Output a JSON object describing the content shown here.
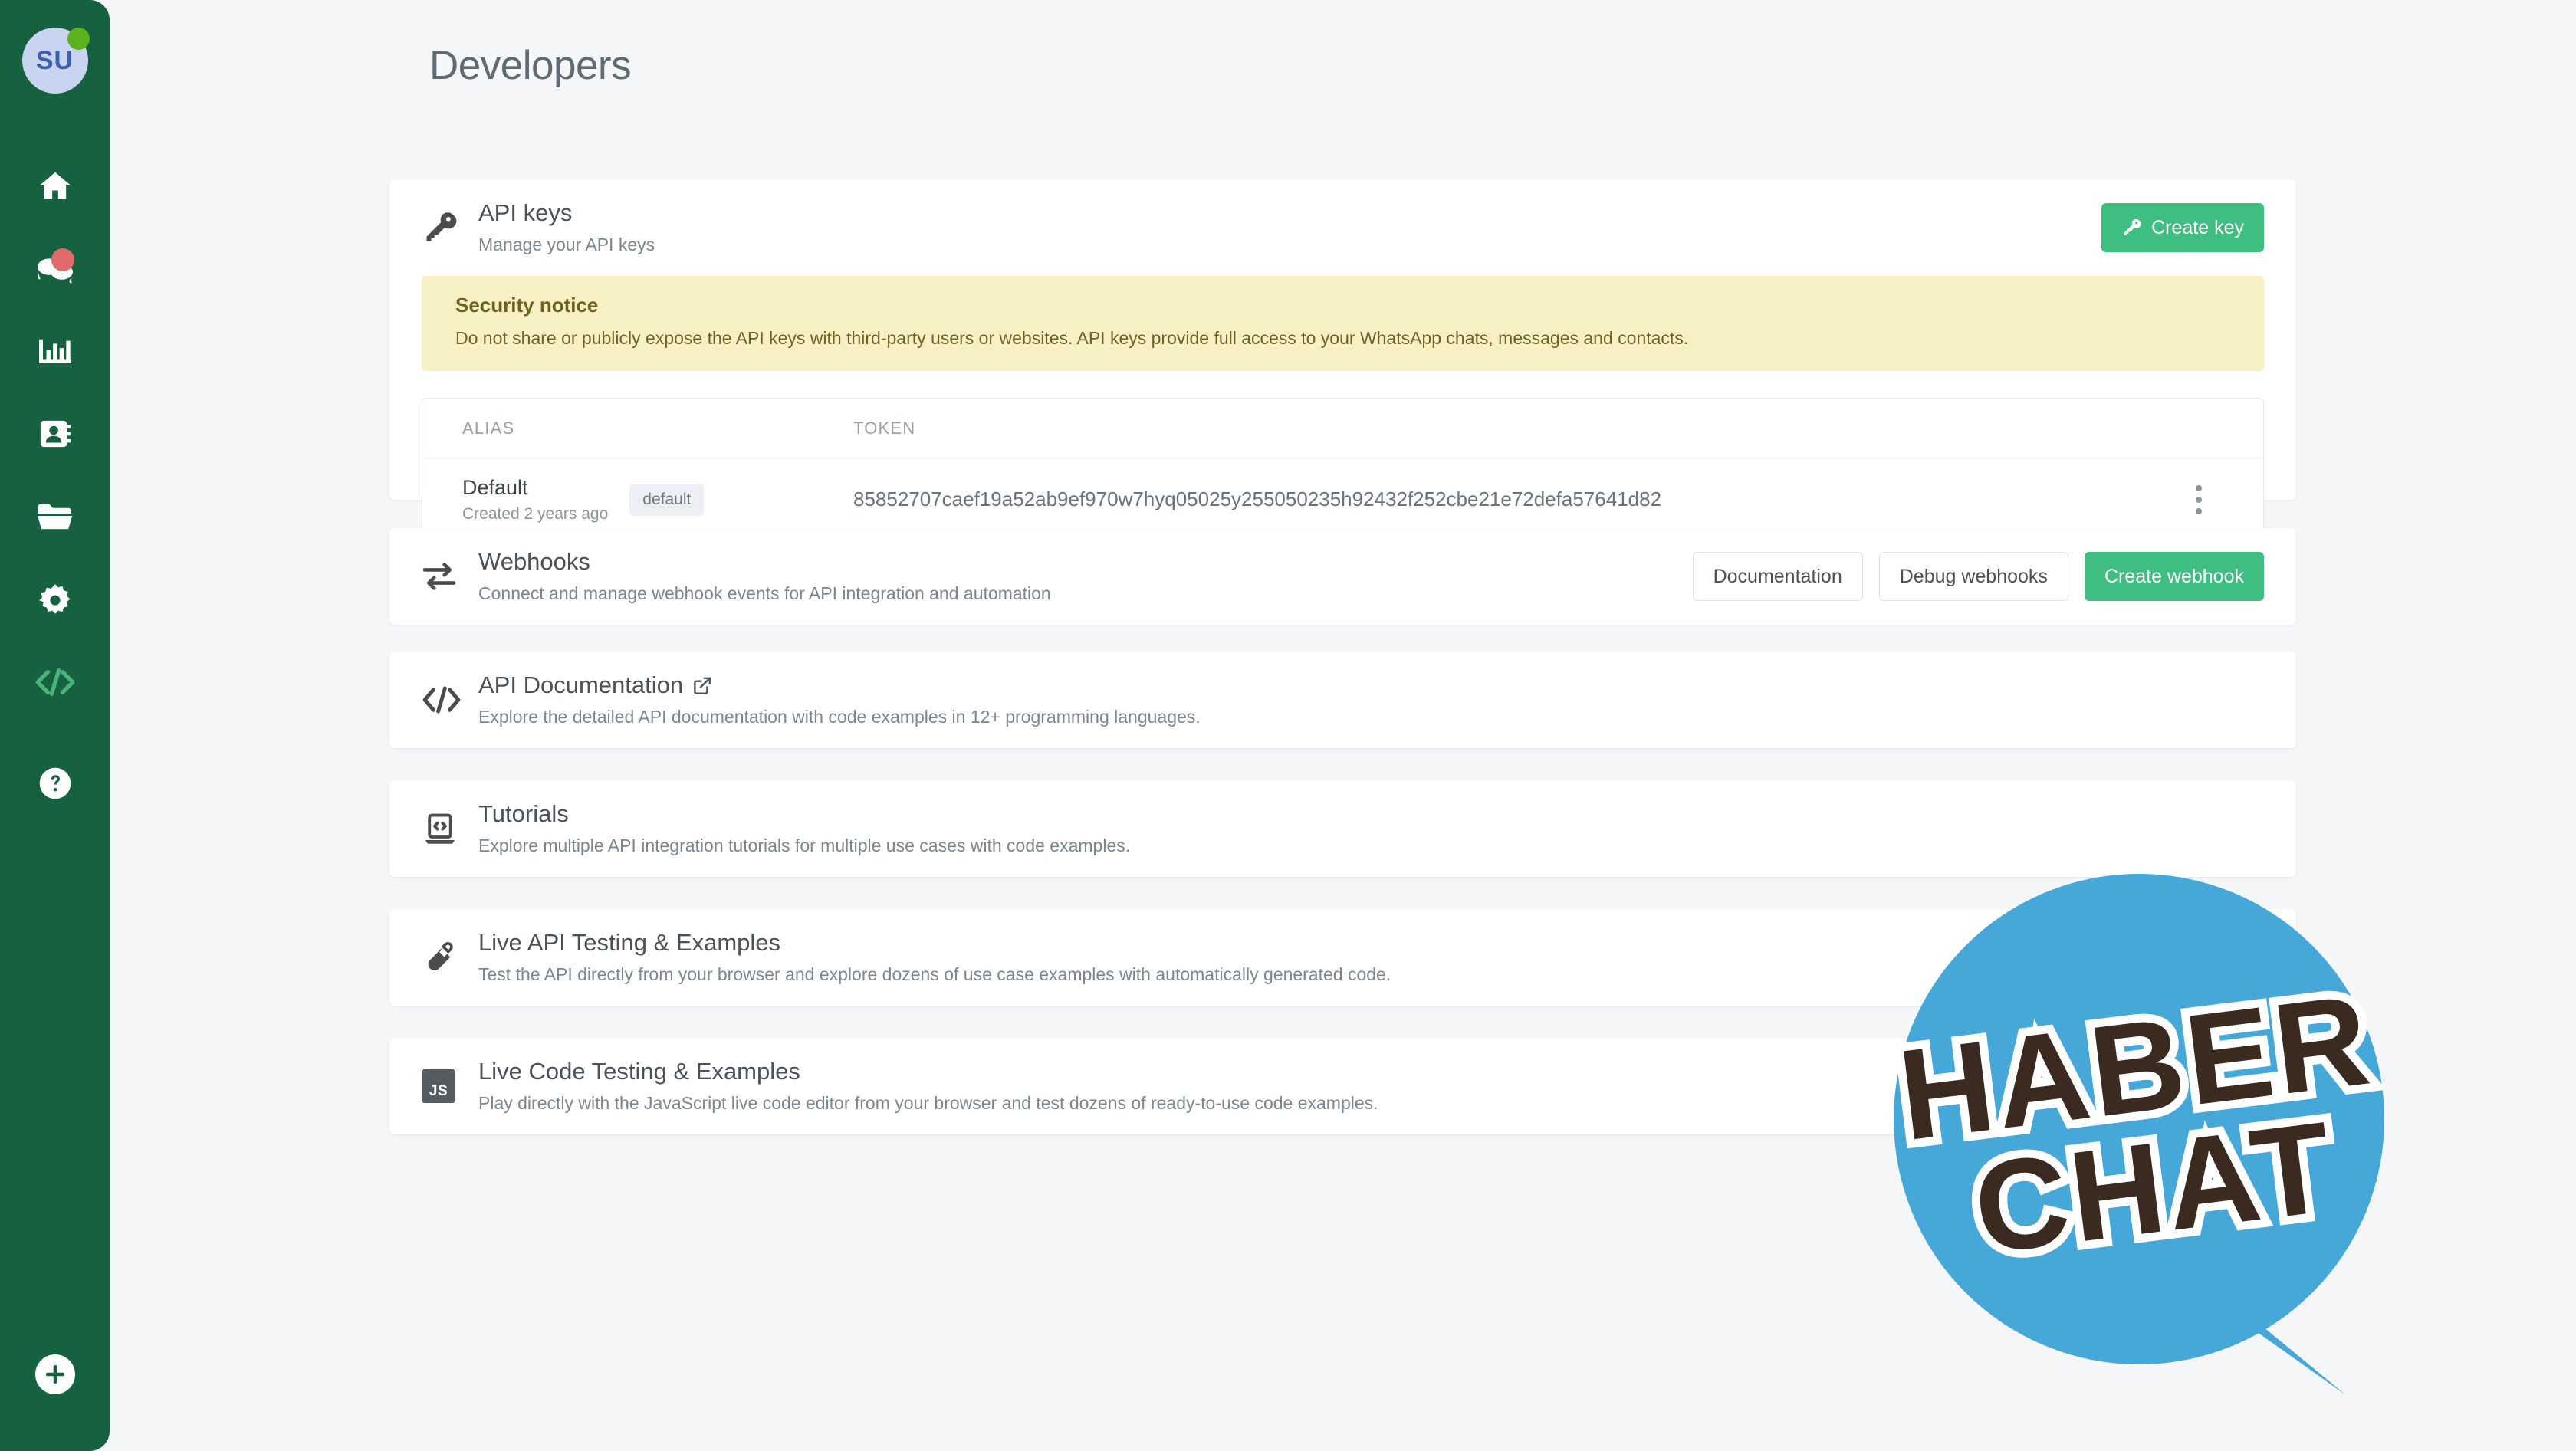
{
  "app": {
    "accent_green": "#3fbe82",
    "sidebar_green": "#156140",
    "page_bg": "#f4f6f8",
    "notice_bg": "#f7f0c4",
    "watermark_blue": "#45a8d8",
    "watermark_brown": "#3a2a20"
  },
  "sidebar": {
    "avatar_initials": "SU",
    "status": "online",
    "items": [
      {
        "name": "home",
        "icon": "home-icon",
        "badge": false
      },
      {
        "name": "chats",
        "icon": "chats-icon",
        "badge": true
      },
      {
        "name": "statistics",
        "icon": "bar-chart-icon",
        "badge": false
      },
      {
        "name": "contacts",
        "icon": "contacts-icon",
        "badge": false
      },
      {
        "name": "files",
        "icon": "folder-icon",
        "badge": false
      },
      {
        "name": "settings",
        "icon": "gear-icon",
        "badge": false
      },
      {
        "name": "developers",
        "icon": "code-icon",
        "badge": false,
        "active": true
      },
      {
        "name": "help",
        "icon": "help-icon",
        "badge": false
      }
    ],
    "add_button": "add-icon"
  },
  "header": {
    "title": "Developers"
  },
  "api_keys": {
    "icon": "key-icon",
    "title": "API keys",
    "subtitle": "Manage your API keys",
    "create_button": "Create key",
    "notice": {
      "title": "Security notice",
      "text": "Do not share or publicly expose the API keys with third-party users or websites. API keys provide full access to your WhatsApp chats, messages and contacts."
    },
    "table": {
      "columns": [
        "ALIAS",
        "TOKEN"
      ],
      "rows": [
        {
          "alias": "Default",
          "created": "Created 2 years ago",
          "chip": "default",
          "token": "85852707caef19a52ab9ef970w7hyq05025y255050235h92432f252cbe21e72defa57641d82",
          "menu": "row-menu"
        }
      ]
    }
  },
  "webhooks": {
    "icon": "transfer-icon",
    "title": "Webhooks",
    "subtitle": "Connect and manage webhook events for API integration and automation",
    "buttons": {
      "documentation": "Documentation",
      "debug": "Debug webhooks",
      "create": "Create webhook"
    }
  },
  "api_documentation": {
    "icon": "code-icon",
    "title": "API Documentation",
    "external_icon": "external-link-icon",
    "subtitle": "Explore the detailed API documentation with code examples in 12+ programming languages."
  },
  "tutorials": {
    "icon": "laptop-code-icon",
    "title": "Tutorials",
    "subtitle": "Explore multiple API integration tutorials for multiple use cases with code examples."
  },
  "live_api_testing": {
    "icon": "test-tube-icon",
    "title": "Live API Testing & Examples",
    "subtitle": "Test the API directly from your browser and explore dozens of use case examples with automatically generated code."
  },
  "live_code_testing": {
    "icon": "js-badge-icon",
    "badge_label": "JS",
    "title": "Live Code Testing & Examples",
    "subtitle": "Play directly with the JavaScript live code editor from your browser and test dozens of ready-to-use code examples."
  },
  "watermark": {
    "line1": "HABER",
    "line2": "CHAT"
  }
}
